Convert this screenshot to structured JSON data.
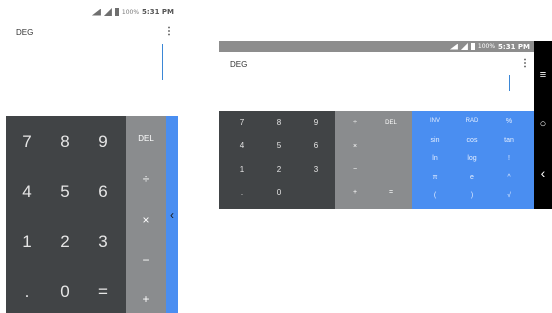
{
  "portrait": {
    "status": {
      "battery": "100%",
      "time": "5:31 PM"
    },
    "display": {
      "mode": "DEG",
      "menu_icon": "⋮"
    },
    "digits": [
      [
        "7",
        "8",
        "9"
      ],
      [
        "4",
        "5",
        "6"
      ],
      [
        "1",
        "2",
        "3"
      ],
      [
        ".",
        "0",
        "="
      ]
    ],
    "ops": [
      "DEL",
      "÷",
      "×",
      "−",
      "+"
    ],
    "expand_icon": "‹"
  },
  "landscape": {
    "status": {
      "battery": "100%",
      "time": "5:31 PM"
    },
    "display": {
      "mode": "DEG",
      "menu_icon": "⋮"
    },
    "digits": [
      [
        "7",
        "8",
        "9"
      ],
      [
        "4",
        "5",
        "6"
      ],
      [
        "1",
        "2",
        "3"
      ],
      [
        ".",
        "0",
        ""
      ]
    ],
    "ops": [
      [
        "÷",
        "DEL"
      ],
      [
        "×",
        ""
      ],
      [
        "−",
        ""
      ],
      [
        "+",
        "="
      ]
    ],
    "sci": [
      [
        "INV",
        "RAD",
        "%"
      ],
      [
        "sin",
        "cos",
        "tan"
      ],
      [
        "ln",
        "log",
        "!"
      ],
      [
        "π",
        "e",
        "^"
      ],
      [
        "(",
        ")",
        "√"
      ]
    ],
    "nav": {
      "menu": "≡",
      "home": "○",
      "back": "‹"
    }
  },
  "colors": {
    "keypad": "#414446",
    "ops": "#8a8c8e",
    "sci": "#4a8ef1",
    "statusbar": "#8d8d8d",
    "accent": "#3b87d6"
  }
}
